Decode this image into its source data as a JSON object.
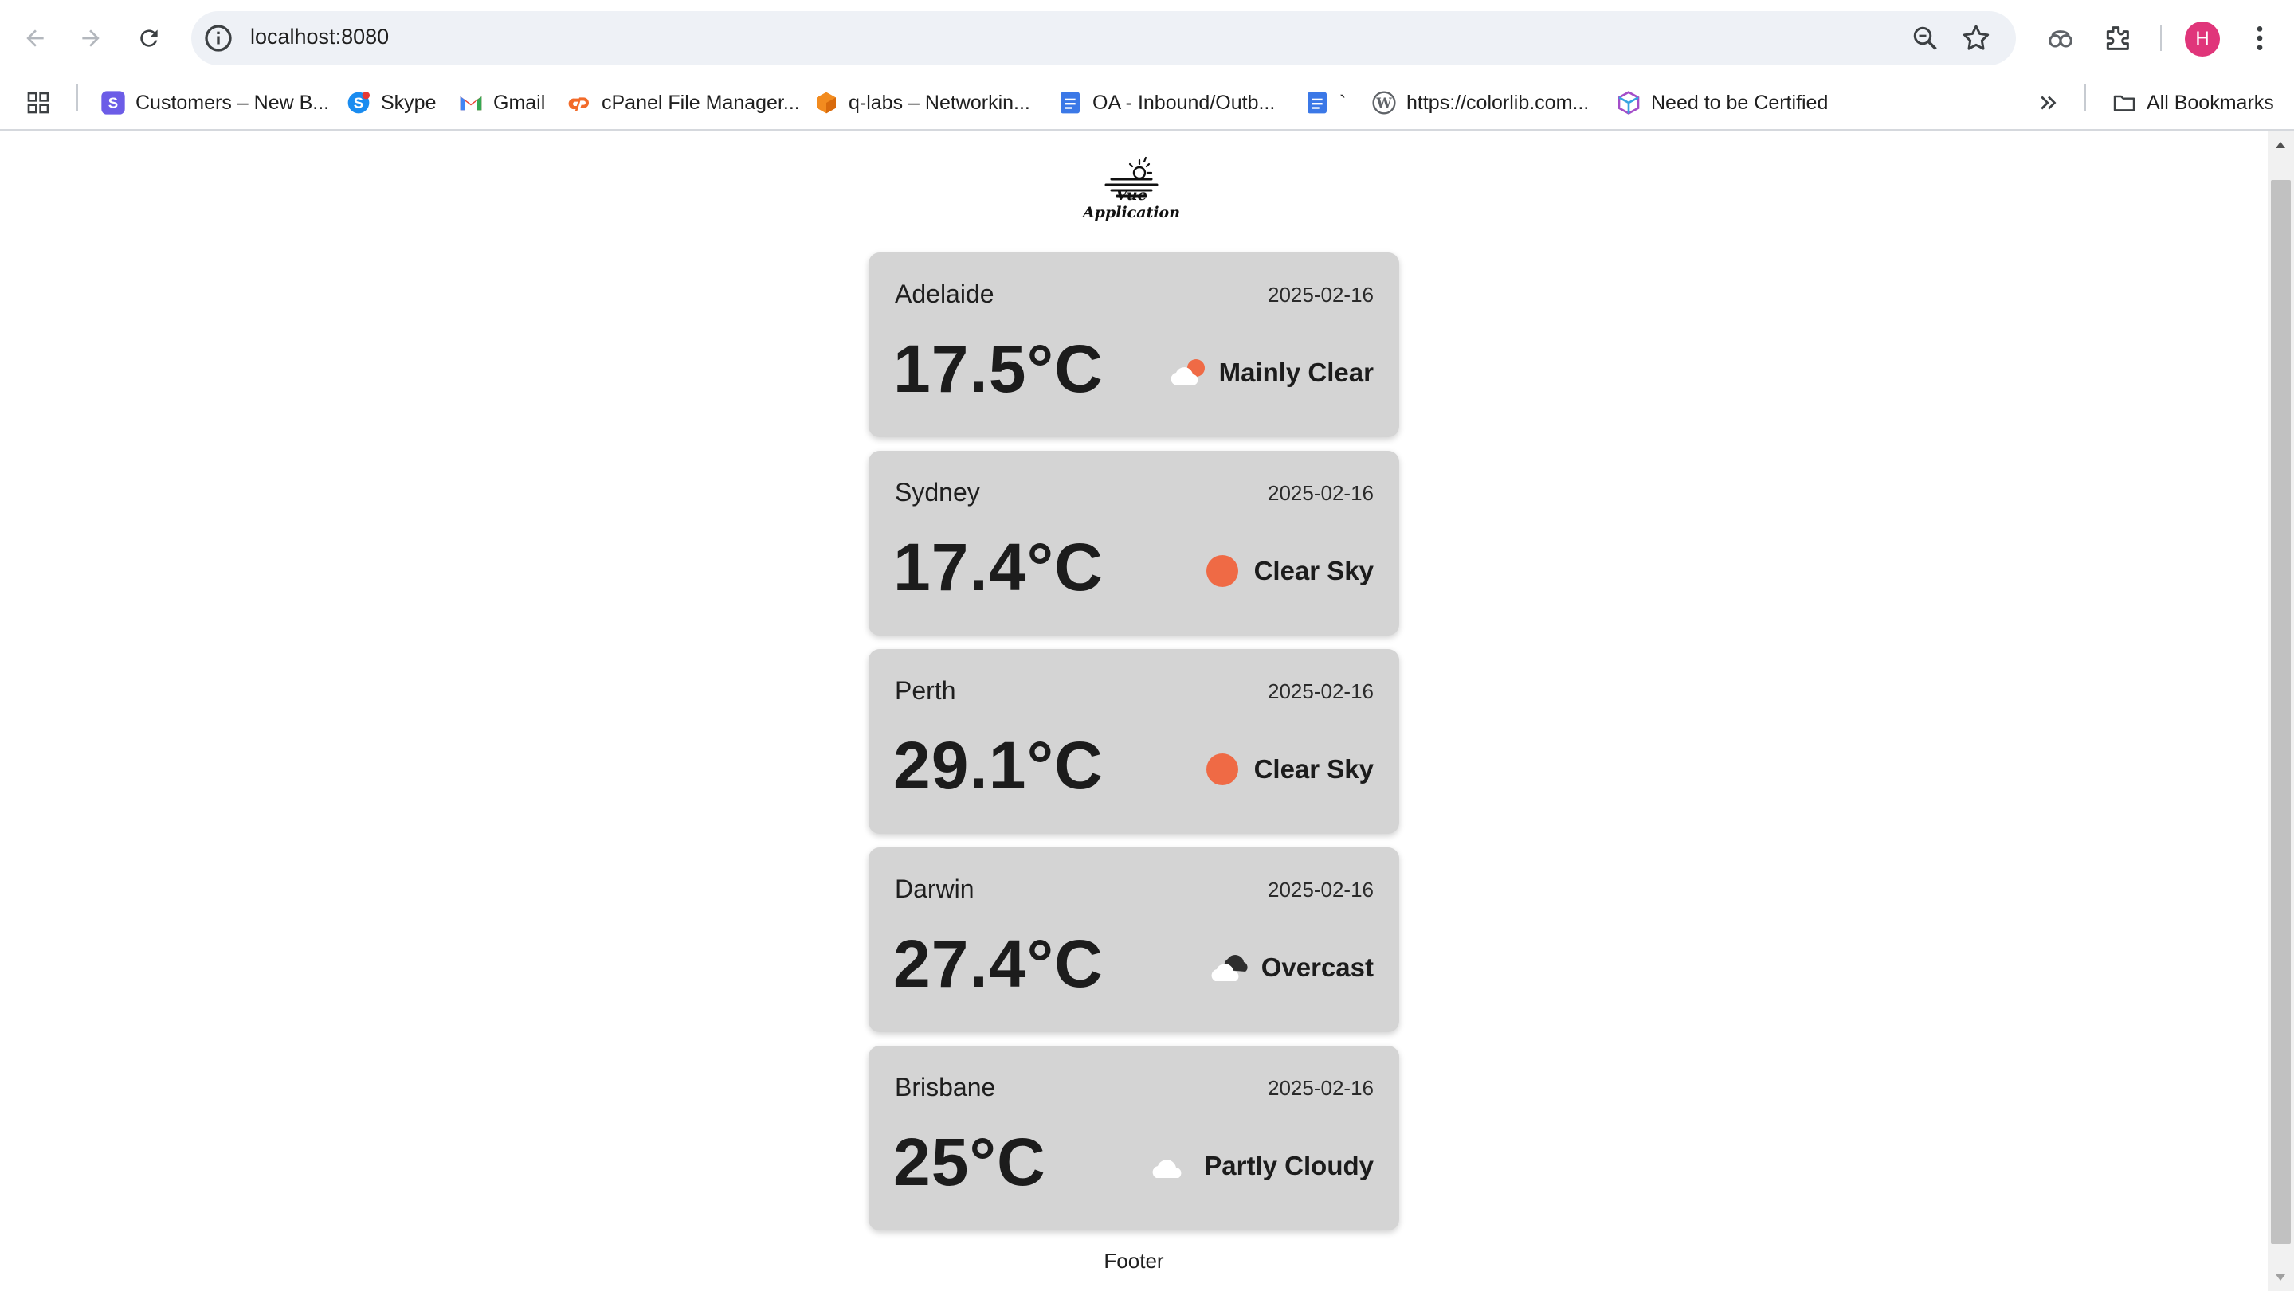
{
  "browser": {
    "url": "localhost:8080",
    "avatar_initial": "H",
    "bookmarks": [
      {
        "label": "Customers – New B...",
        "icon": "s-brand-icon"
      },
      {
        "label": "Skype",
        "icon": "skype-icon"
      },
      {
        "label": "Gmail",
        "icon": "gmail-icon"
      },
      {
        "label": "cPanel File Manager...",
        "icon": "cpanel-icon"
      },
      {
        "label": "q-labs – Networkin...",
        "icon": "cube-icon"
      },
      {
        "label": "OA - Inbound/Outb...",
        "icon": "docs-icon"
      },
      {
        "label": "`",
        "icon": "docs-icon"
      },
      {
        "label": "https://colorlib.com...",
        "icon": "wordpress-icon"
      },
      {
        "label": "Need to be Certified",
        "icon": "box-icon"
      }
    ],
    "all_bookmarks_label": "All Bookmarks"
  },
  "app": {
    "logo_text": "Vue Application",
    "footer": "Footer"
  },
  "weather": [
    {
      "city": "Adelaide",
      "date": "2025-02-16",
      "temp": "17.5°C",
      "condition": "Mainly Clear",
      "icon": "mainly-clear-icon"
    },
    {
      "city": "Sydney",
      "date": "2025-02-16",
      "temp": "17.4°C",
      "condition": "Clear Sky",
      "icon": "clear-sky-icon"
    },
    {
      "city": "Perth",
      "date": "2025-02-16",
      "temp": "29.1°C",
      "condition": "Clear Sky",
      "icon": "clear-sky-icon"
    },
    {
      "city": "Darwin",
      "date": "2025-02-16",
      "temp": "27.4°C",
      "condition": "Overcast",
      "icon": "overcast-icon"
    },
    {
      "city": "Brisbane",
      "date": "2025-02-16",
      "temp": "25°C",
      "condition": "Partly Cloudy",
      "icon": "partly-cloudy-icon"
    }
  ],
  "colors": {
    "card_bg": "#d4d4d4",
    "sun": "#ef6a45",
    "cloud": "#ffffff",
    "dark_cloud": "#2e2e2e",
    "avatar": "#e0357a"
  }
}
